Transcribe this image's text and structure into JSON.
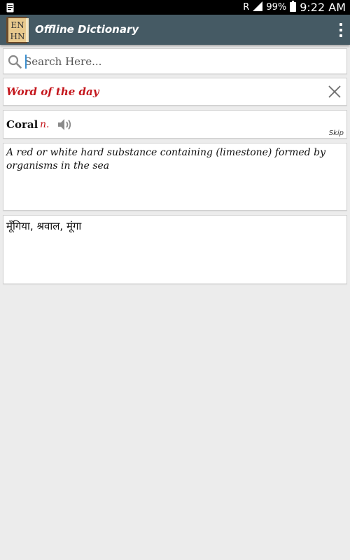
{
  "status_bar": {
    "network": "R",
    "battery": "99%",
    "time": "9:22 AM"
  },
  "app_bar": {
    "logo_top": "EN",
    "logo_bottom": "HN",
    "title": "Offline Dictionary"
  },
  "search": {
    "placeholder": "Search Here..."
  },
  "word_of_day": {
    "title": "Word of the day",
    "word": "Coral",
    "part_of_speech": "n.",
    "skip_label": "Skip",
    "definition": "A red or white hard substance containing (limestone) formed by organisms in the sea",
    "hindi": "मूँगिया, श्रवाल, मूंगा"
  },
  "colors": {
    "app_bar": "#455a64",
    "accent_red": "#c4161c",
    "background": "#ececec"
  }
}
